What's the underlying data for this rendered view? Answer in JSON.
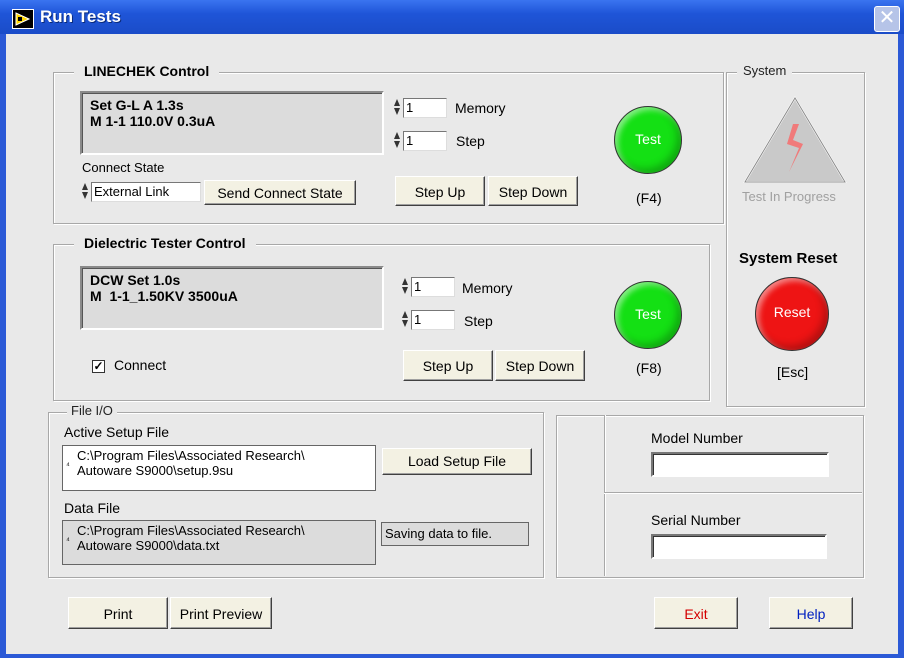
{
  "window": {
    "title": "Run Tests",
    "close_glyph": "✕"
  },
  "linechek": {
    "title": "LINECHEK Control",
    "display_line1": "Set G-L A 1.3s",
    "display_line2": "M 1-1 110.0V 0.3uA",
    "memory_value": "1",
    "memory_label": "Memory",
    "step_value": "1",
    "step_label": "Step",
    "connect_state_label": "Connect State",
    "connect_state_value": "External Link",
    "send_button": "Send Connect State",
    "step_up": "Step Up",
    "step_down": "Step Down",
    "test_button": "Test",
    "test_key": "(F4)",
    "test_color": "#14e014"
  },
  "system": {
    "title": "System",
    "progress_label": "Test In Progress",
    "reset_title": "System Reset",
    "reset_button": "Reset",
    "reset_key": "[Esc]",
    "reset_color": "#ee1414"
  },
  "dielectric": {
    "title": "Dielectric Tester Control",
    "display_line1": "DCW Set 1.0s",
    "display_line2": "M  1-1_1.50KV 3500uA",
    "memory_value": "1",
    "memory_label": "Memory",
    "step_value": "1",
    "step_label": "Step",
    "connect_label": "Connect",
    "connect_checked": "✓",
    "step_up": "Step Up",
    "step_down": "Step Down",
    "test_button": "Test",
    "test_key": "(F8)"
  },
  "file_io": {
    "title": "File I/O",
    "active_setup_label": "Active Setup File",
    "active_setup_line1": "C:\\Program Files\\Associated Research\\",
    "active_setup_line2": "Autoware S9000\\setup.9su",
    "load_button": "Load Setup File",
    "data_file_label": "Data File",
    "data_file_line1": "C:\\Program Files\\Associated Research\\",
    "data_file_line2": "Autoware S9000\\data.txt",
    "saving_status": "Saving data to file."
  },
  "device": {
    "model_label": "Model Number",
    "model_value": "",
    "serial_label": "Serial Number",
    "serial_value": ""
  },
  "footer": {
    "print": "Print",
    "print_preview": "Print Preview",
    "exit": "Exit",
    "help": "Help",
    "exit_color": "#d40000",
    "help_color": "#0020c0"
  }
}
